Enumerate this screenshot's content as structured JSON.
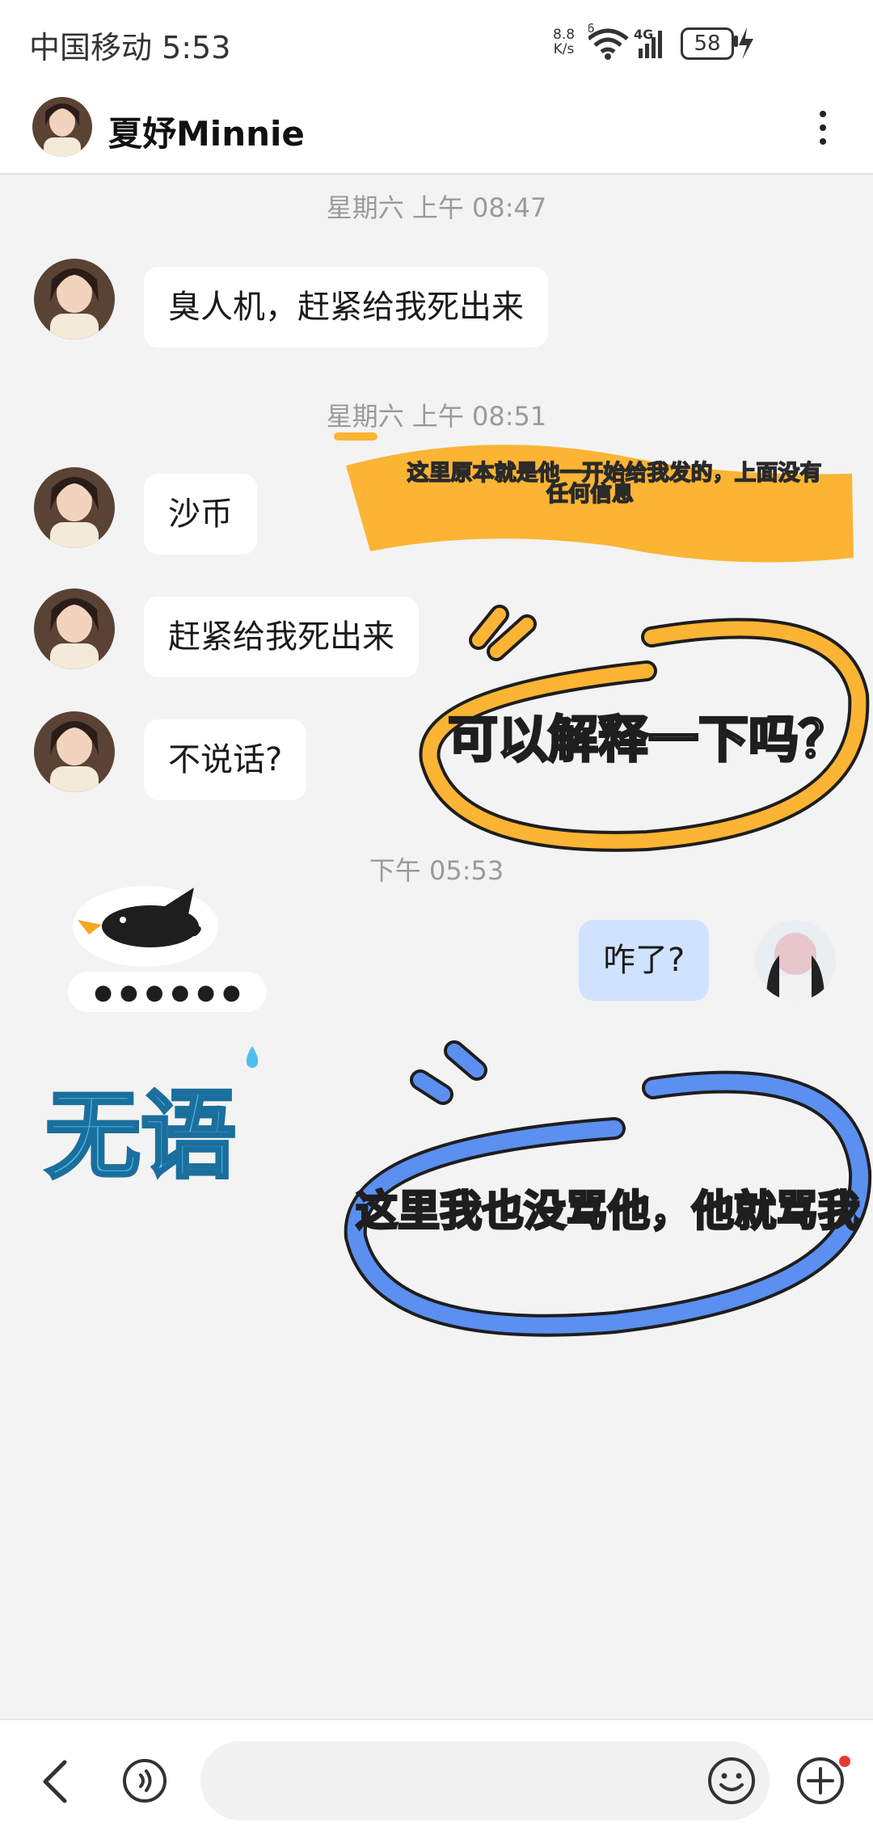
{
  "status_bar": {
    "carrier_time": "中国移动 5:53",
    "net_speed_value": "8.8",
    "net_speed_unit": "K/s",
    "signal_label": "4G",
    "wifi_badge": "6",
    "battery": "58"
  },
  "header": {
    "contact_name": "夏妤Minnie"
  },
  "messages": {
    "ts1": "星期六 上午 08:47",
    "m1": "臭人机，赶紧给我死出来",
    "ts2": "星期六 上午 08:51",
    "m2": "沙币",
    "m3": "赶紧给我死出来",
    "m4": "不说话?",
    "ts3": "下午 05:53",
    "m5_dots": "● ● ● ● ● ●",
    "m6_sticker": "无语",
    "m7": "咋了?"
  },
  "annotations": {
    "note1": "这里原本就是他一开始给我发的，上面没有任何信息",
    "note1_line1": "这里原本就是他一开始给我发的，上面没有",
    "note1_line2": "任何信息",
    "note2": "可以解释一下吗？",
    "note3": "这里我也没骂他，他就骂我"
  },
  "icons": {
    "back": "chevron-left-icon",
    "voice": "voice-icon",
    "emoji": "emoji-icon",
    "add": "add-circle-icon",
    "more": "more-vertical-icon"
  },
  "colors": {
    "bubble_other": "#ffffff",
    "bubble_mine": "#cfe2ff",
    "highlight_orange": "#fbb434",
    "highlight_blue": "#5b8ff0",
    "sticker_blue": "#4cbfee",
    "notification_dot": "#e83a30"
  }
}
